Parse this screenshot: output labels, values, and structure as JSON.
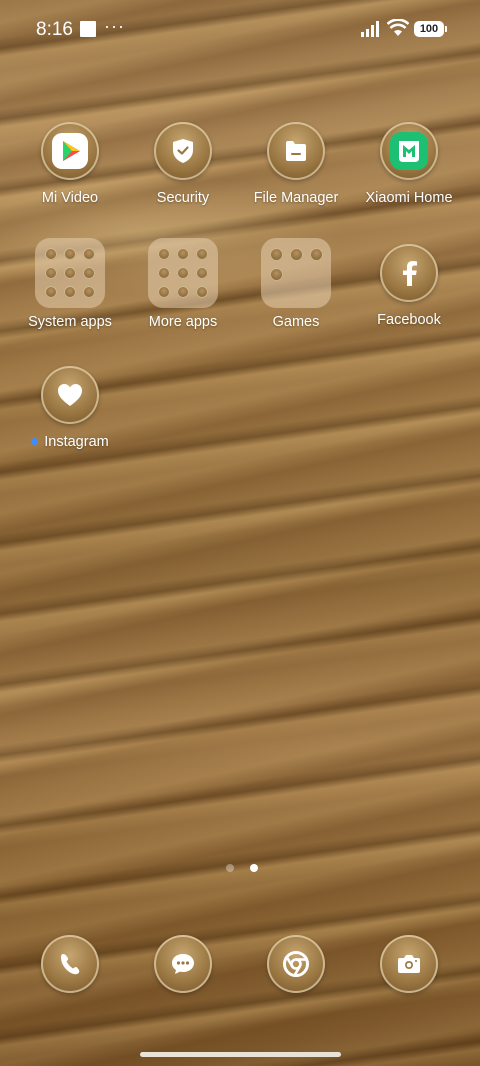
{
  "status_bar": {
    "time": "8:16",
    "more_indicator": "···",
    "battery_level": "100"
  },
  "apps": [
    {
      "label": "Mi Video",
      "icon": "mi-video-icon"
    },
    {
      "label": "Security",
      "icon": "shield-check-icon"
    },
    {
      "label": "File Manager",
      "icon": "folder-icon"
    },
    {
      "label": "Xiaomi Home",
      "icon": "xiaomi-home-icon"
    },
    {
      "label": "System apps",
      "icon": "folder-grid"
    },
    {
      "label": "More apps",
      "icon": "folder-grid"
    },
    {
      "label": "Games",
      "icon": "folder-grid"
    },
    {
      "label": "Facebook",
      "icon": "facebook-icon"
    },
    {
      "label": "Instagram",
      "icon": "heart-icon",
      "new_indicator": true
    }
  ],
  "dock": [
    {
      "name": "Phone",
      "icon": "phone-icon"
    },
    {
      "name": "Messages",
      "icon": "message-icon"
    },
    {
      "name": "Chrome",
      "icon": "chrome-icon"
    },
    {
      "name": "Camera",
      "icon": "camera-icon"
    }
  ],
  "pager": {
    "pages": 2,
    "current": 2
  },
  "colors": {
    "accent_dot": "#3f8cff",
    "xiaomi_home": "#1dbf73"
  }
}
